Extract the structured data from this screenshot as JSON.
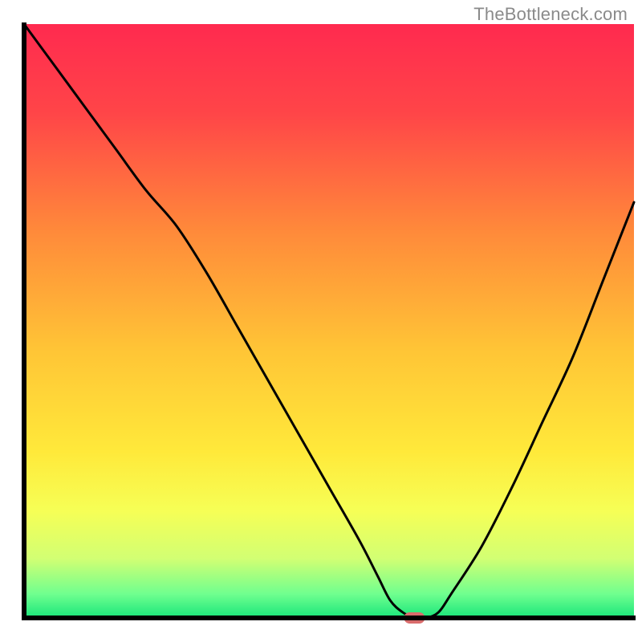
{
  "watermark": "TheBottleneck.com",
  "chart_data": {
    "type": "line",
    "title": "",
    "xlabel": "",
    "ylabel": "",
    "xlim": [
      0,
      100
    ],
    "ylim": [
      0,
      100
    ],
    "x": [
      0,
      5,
      10,
      15,
      20,
      25,
      30,
      35,
      40,
      45,
      50,
      55,
      58,
      60,
      62,
      64,
      66,
      68,
      70,
      75,
      80,
      85,
      90,
      95,
      100
    ],
    "values": [
      100,
      93,
      86,
      79,
      72,
      66,
      58,
      49,
      40,
      31,
      22,
      13,
      7,
      3,
      1,
      0,
      0,
      1,
      4,
      12,
      22,
      33,
      44,
      57,
      70
    ],
    "marker": {
      "x": 64,
      "y": 0,
      "color": "#d96c6c",
      "shape": "rounded-rect"
    },
    "background": {
      "type": "gradient",
      "stops": [
        {
          "offset": 0.0,
          "color": "#ff2a4f"
        },
        {
          "offset": 0.15,
          "color": "#ff4548"
        },
        {
          "offset": 0.35,
          "color": "#ff8a3a"
        },
        {
          "offset": 0.55,
          "color": "#ffc536"
        },
        {
          "offset": 0.72,
          "color": "#ffe93a"
        },
        {
          "offset": 0.82,
          "color": "#f6ff56"
        },
        {
          "offset": 0.9,
          "color": "#d2ff73"
        },
        {
          "offset": 0.96,
          "color": "#6fff8f"
        },
        {
          "offset": 1.0,
          "color": "#19e57a"
        }
      ]
    },
    "axis_stroke": "#000000",
    "axis_width": 6,
    "curve_stroke": "#000000",
    "curve_width": 3
  }
}
